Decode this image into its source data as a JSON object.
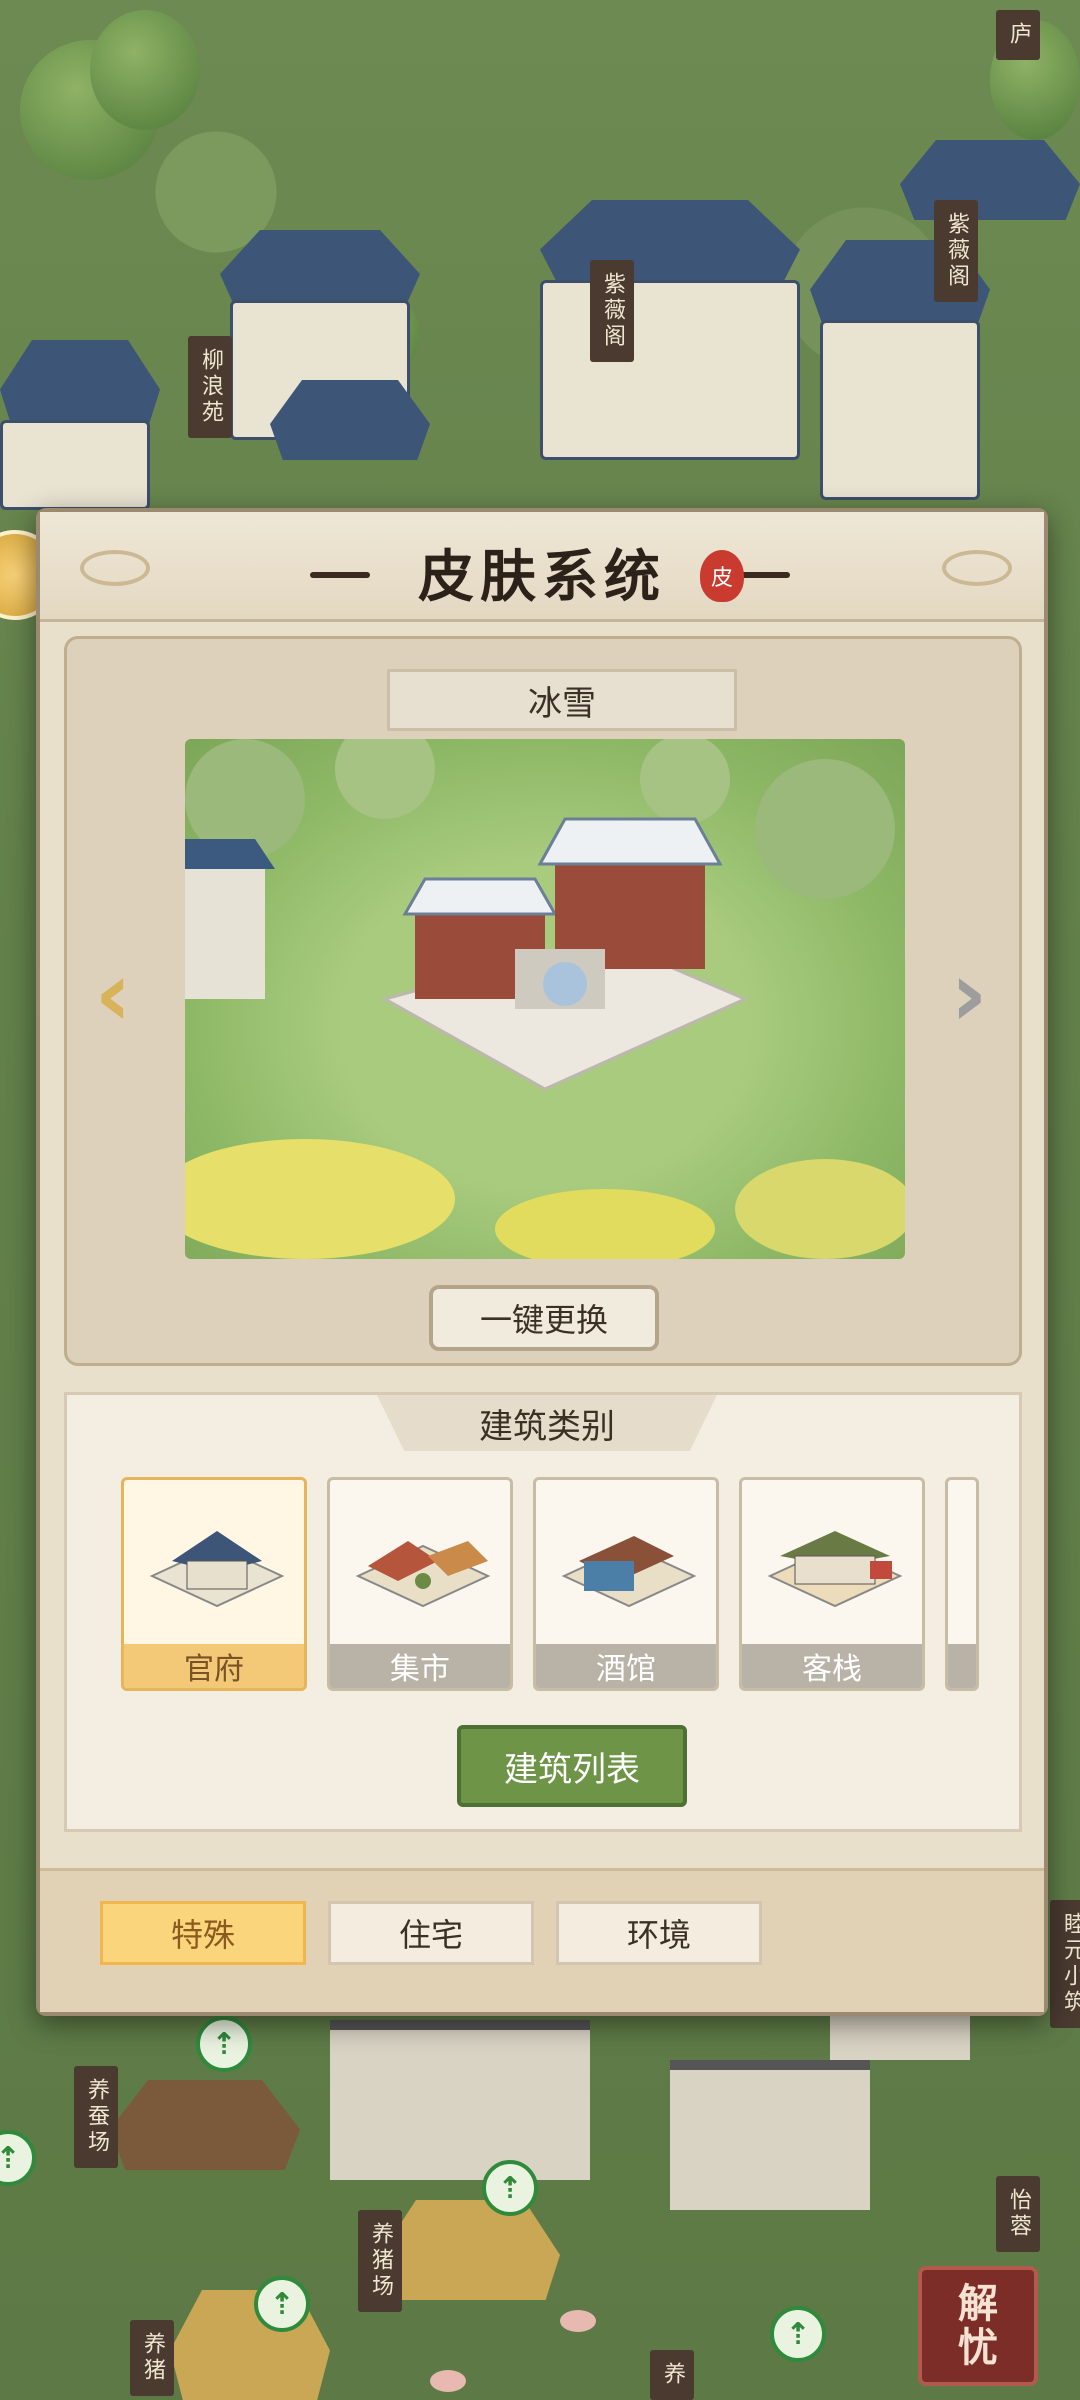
{
  "background": {
    "labels": {
      "liulangyuan": "柳浪苑",
      "ziweige_1": "紫薇阁",
      "ziweige_2": "紫薇阁",
      "lu": "庐",
      "yangcanchang": "养蚕场",
      "yangzhuchang": "养猪场",
      "yangzhu_2": "养猪",
      "muyuanxiaozhu": "睦元小筑",
      "yirong": "怡蓉",
      "yang_short": "养"
    }
  },
  "panel": {
    "title": "皮肤系统",
    "seal_char": "皮",
    "preview": {
      "skin_name": "冰雪",
      "prev_arrow": "‹",
      "next_arrow": "›",
      "change_button": "一键更换"
    },
    "category": {
      "title": "建筑类别",
      "cards": [
        {
          "label": "官府",
          "selected": true
        },
        {
          "label": "集市",
          "selected": false
        },
        {
          "label": "酒馆",
          "selected": false
        },
        {
          "label": "客栈",
          "selected": false
        }
      ],
      "list_button": "建筑列表"
    },
    "tabs": [
      {
        "label": "特殊",
        "active": true
      },
      {
        "label": "住宅",
        "active": false
      },
      {
        "label": "环境",
        "active": false
      }
    ]
  },
  "resolve_button": {
    "line1": "解",
    "line2": "忧"
  },
  "colors": {
    "accent_gold": "#fbd57c",
    "button_green": "#6e9448",
    "panel_bg": "#e9e0cc",
    "resolve_red": "#7c2d27"
  }
}
